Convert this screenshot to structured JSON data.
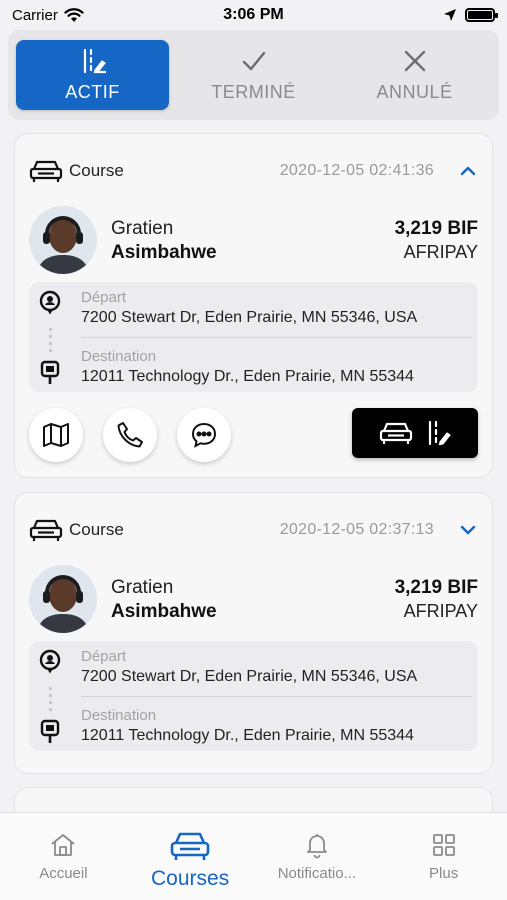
{
  "status_bar": {
    "carrier": "Carrier",
    "time": "3:06 PM"
  },
  "tabs": [
    {
      "label": "ACTIF",
      "icon": "route-edit-icon",
      "active": true
    },
    {
      "label": "TERMINÉ",
      "icon": "check-icon",
      "active": false
    },
    {
      "label": "ANNULÉ",
      "icon": "close-icon",
      "active": false
    }
  ],
  "rides": [
    {
      "type": "Course",
      "datetime": "2020-12-05 02:41:36",
      "expanded": true,
      "driver_first": "Gratien",
      "driver_last": "Asimbahwe",
      "price": "3,219 BIF",
      "payment": "AFRIPAY",
      "departure_label": "Départ",
      "departure_address": "7200 Stewart Dr, Eden Prairie, MN 55346, USA",
      "destination_label": "Destination",
      "destination_address": "12011 Technology Dr., Eden Prairie, MN 55344"
    },
    {
      "type": "Course",
      "datetime": "2020-12-05 02:37:13",
      "expanded": false,
      "driver_first": "Gratien",
      "driver_last": "Asimbahwe",
      "price": "3,219 BIF",
      "payment": "AFRIPAY",
      "departure_label": "Départ",
      "departure_address": "7200 Stewart Dr, Eden Prairie, MN 55346, USA",
      "destination_label": "Destination",
      "destination_address": "12011 Technology Dr., Eden Prairie, MN 55344"
    }
  ],
  "bottom_nav": [
    {
      "label": "Accueil",
      "icon": "home-icon",
      "active": false
    },
    {
      "label": "Courses",
      "icon": "car-icon",
      "active": true
    },
    {
      "label": "Notificatio...",
      "icon": "bell-icon",
      "active": false
    },
    {
      "label": "Plus",
      "icon": "grid-icon",
      "active": false
    }
  ],
  "colors": {
    "accent": "#1666c5",
    "background": "#f2f2f4",
    "card": "#f7f7f7",
    "button_dark": "#000000"
  }
}
